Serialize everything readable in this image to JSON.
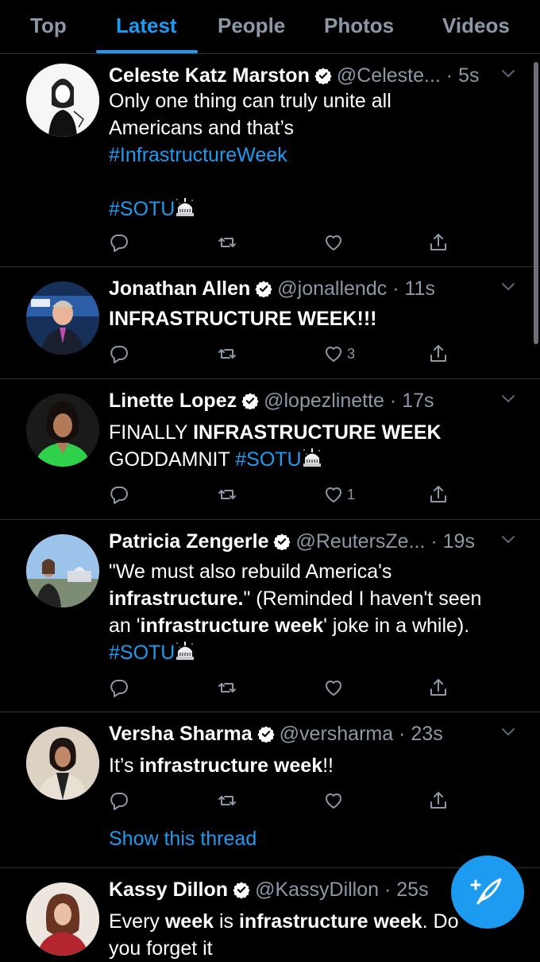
{
  "tabs": [
    "Top",
    "Latest",
    "People",
    "Photos",
    "Videos"
  ],
  "tweets": [
    {
      "name": "Celeste Katz Marston",
      "handle": "@Celeste...",
      "time": "· 5s",
      "line1": "Only one thing can truly unite all",
      "line2": "Americans and that’s",
      "line3_tag": "#InfrastructureWeek",
      "line4_tag": "#SOTU",
      "likes": ""
    },
    {
      "name": "Jonathan Allen",
      "handle": "@jonallendc",
      "time": "· 11s",
      "line1": "INFRASTRUCTURE WEEK!!!",
      "likes": "3"
    },
    {
      "name": "Linette Lopez",
      "handle": "@lopezlinette",
      "time": "· 17s",
      "line1_a": "FINALLY ",
      "line1_b": "INFRASTRUCTURE WEEK",
      "line2_a": "GODDAMNIT ",
      "line2_tag": "#SOTU",
      "likes": "1"
    },
    {
      "name": "Patricia Zengerle",
      "handle": "@ReutersZe...",
      "time": "· 19s",
      "line1": "\"We must also rebuild America's",
      "line2_b": "infrastructure.",
      "line2_a": "\" (Reminded I haven't seen",
      "line3_a": "an '",
      "line3_b": "infrastructure week",
      "line3_c": "' joke in a while).",
      "line4_tag": "#SOTU",
      "likes": ""
    },
    {
      "name": "Versha Sharma",
      "handle": "@versharma",
      "time": "· 23s",
      "line1_a": "It’s ",
      "line1_b": "infrastructure week",
      "line1_c": "!!",
      "thread": "Show this thread",
      "likes": ""
    },
    {
      "name": "Kassy Dillon",
      "handle": "@KassyDillon",
      "time": "· 25s",
      "line1_a": "Every ",
      "line1_b": "week",
      "line1_c": " is ",
      "line1_d": "infrastructure week",
      "line1_e": ". Do",
      "line2": "you forget it"
    }
  ],
  "colors": {
    "accent": "#1d9bf0",
    "muted": "#8b98a5",
    "divider": "#2f3336"
  }
}
